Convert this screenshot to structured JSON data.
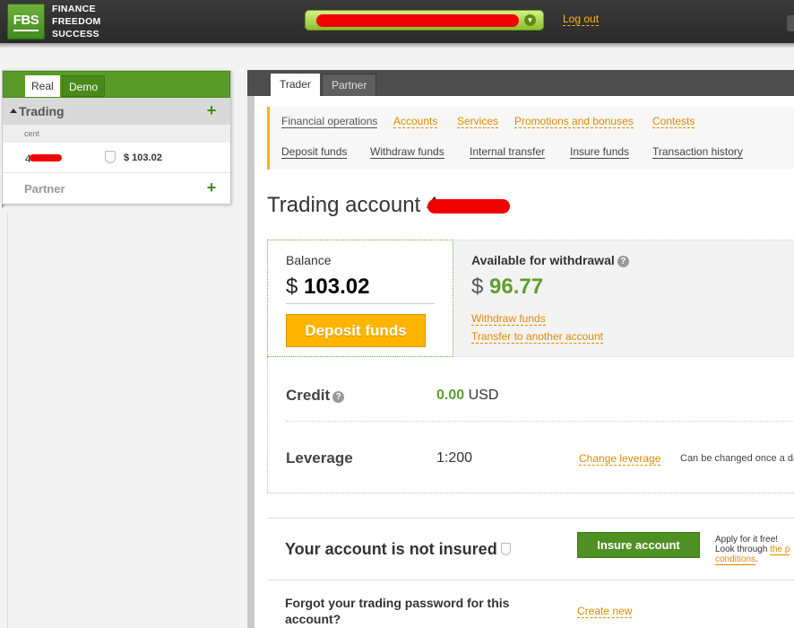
{
  "header": {
    "logo_abbr": "FBS",
    "logo_lines": [
      "FINANCE",
      "FREEDOM",
      "SUCCESS"
    ],
    "logout": "Log out"
  },
  "sidebar": {
    "tabs": [
      "Real",
      "Demo"
    ],
    "trading_title": "Trading",
    "account_type": "cent",
    "account_number_visible": "4",
    "account_balance": "$ 103.02",
    "partner_title": "Partner"
  },
  "main_tabs": [
    "Trader",
    "Partner"
  ],
  "subnav": {
    "primary": [
      "Financial operations",
      "Accounts",
      "Services",
      "Promotions and bonuses",
      "Contests"
    ],
    "secondary": [
      "Deposit funds",
      "Withdraw funds",
      "Internal transfer",
      "Insure funds",
      "Transaction history"
    ]
  },
  "page_title": "Trading account 4",
  "balance": {
    "label": "Balance",
    "currency": "$",
    "value": "103.02",
    "deposit_button": "Deposit funds"
  },
  "withdrawal": {
    "label": "Available for withdrawal",
    "currency": "$",
    "value": "96.77",
    "links": [
      "Withdraw funds",
      "Transfer to another account"
    ]
  },
  "details": {
    "credit_label": "Credit",
    "credit_value": "0.00",
    "credit_currency": "USD",
    "leverage_label": "Leverage",
    "leverage_value": "1:200",
    "change_leverage": "Change leverage",
    "change_note": "Can be changed once a day o"
  },
  "insurance": {
    "title": "Your account is not insured",
    "button": "Insure account",
    "note_line1": "Apply for it free!",
    "note_line2_prefix": "Look through ",
    "note_link1": "the p",
    "note_link2": "conditions",
    "note_suffix": "."
  },
  "password": {
    "text": "Forgot your trading password for this account?",
    "link": "Create new"
  },
  "colors": {
    "brand_green": "#5a9a27",
    "accent_orange": "#ffb400",
    "link_orange": "#e08a00",
    "value_green": "#5f9e2f",
    "redaction_red": "#f10000"
  }
}
